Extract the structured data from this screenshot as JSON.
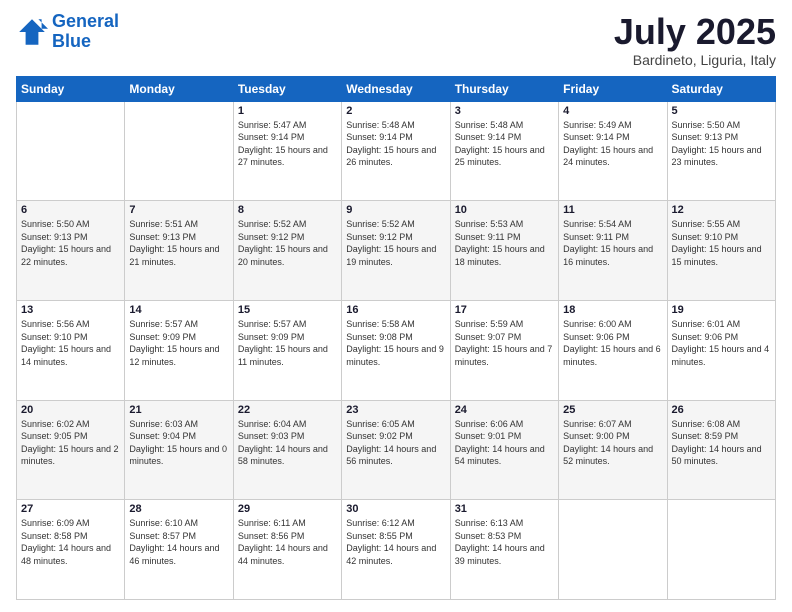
{
  "logo": {
    "line1": "General",
    "line2": "Blue"
  },
  "title": "July 2025",
  "location": "Bardineto, Liguria, Italy",
  "days_of_week": [
    "Sunday",
    "Monday",
    "Tuesday",
    "Wednesday",
    "Thursday",
    "Friday",
    "Saturday"
  ],
  "weeks": [
    [
      {
        "day": "",
        "sunrise": "",
        "sunset": "",
        "daylight": ""
      },
      {
        "day": "",
        "sunrise": "",
        "sunset": "",
        "daylight": ""
      },
      {
        "day": "1",
        "sunrise": "Sunrise: 5:47 AM",
        "sunset": "Sunset: 9:14 PM",
        "daylight": "Daylight: 15 hours and 27 minutes."
      },
      {
        "day": "2",
        "sunrise": "Sunrise: 5:48 AM",
        "sunset": "Sunset: 9:14 PM",
        "daylight": "Daylight: 15 hours and 26 minutes."
      },
      {
        "day": "3",
        "sunrise": "Sunrise: 5:48 AM",
        "sunset": "Sunset: 9:14 PM",
        "daylight": "Daylight: 15 hours and 25 minutes."
      },
      {
        "day": "4",
        "sunrise": "Sunrise: 5:49 AM",
        "sunset": "Sunset: 9:14 PM",
        "daylight": "Daylight: 15 hours and 24 minutes."
      },
      {
        "day": "5",
        "sunrise": "Sunrise: 5:50 AM",
        "sunset": "Sunset: 9:13 PM",
        "daylight": "Daylight: 15 hours and 23 minutes."
      }
    ],
    [
      {
        "day": "6",
        "sunrise": "Sunrise: 5:50 AM",
        "sunset": "Sunset: 9:13 PM",
        "daylight": "Daylight: 15 hours and 22 minutes."
      },
      {
        "day": "7",
        "sunrise": "Sunrise: 5:51 AM",
        "sunset": "Sunset: 9:13 PM",
        "daylight": "Daylight: 15 hours and 21 minutes."
      },
      {
        "day": "8",
        "sunrise": "Sunrise: 5:52 AM",
        "sunset": "Sunset: 9:12 PM",
        "daylight": "Daylight: 15 hours and 20 minutes."
      },
      {
        "day": "9",
        "sunrise": "Sunrise: 5:52 AM",
        "sunset": "Sunset: 9:12 PM",
        "daylight": "Daylight: 15 hours and 19 minutes."
      },
      {
        "day": "10",
        "sunrise": "Sunrise: 5:53 AM",
        "sunset": "Sunset: 9:11 PM",
        "daylight": "Daylight: 15 hours and 18 minutes."
      },
      {
        "day": "11",
        "sunrise": "Sunrise: 5:54 AM",
        "sunset": "Sunset: 9:11 PM",
        "daylight": "Daylight: 15 hours and 16 minutes."
      },
      {
        "day": "12",
        "sunrise": "Sunrise: 5:55 AM",
        "sunset": "Sunset: 9:10 PM",
        "daylight": "Daylight: 15 hours and 15 minutes."
      }
    ],
    [
      {
        "day": "13",
        "sunrise": "Sunrise: 5:56 AM",
        "sunset": "Sunset: 9:10 PM",
        "daylight": "Daylight: 15 hours and 14 minutes."
      },
      {
        "day": "14",
        "sunrise": "Sunrise: 5:57 AM",
        "sunset": "Sunset: 9:09 PM",
        "daylight": "Daylight: 15 hours and 12 minutes."
      },
      {
        "day": "15",
        "sunrise": "Sunrise: 5:57 AM",
        "sunset": "Sunset: 9:09 PM",
        "daylight": "Daylight: 15 hours and 11 minutes."
      },
      {
        "day": "16",
        "sunrise": "Sunrise: 5:58 AM",
        "sunset": "Sunset: 9:08 PM",
        "daylight": "Daylight: 15 hours and 9 minutes."
      },
      {
        "day": "17",
        "sunrise": "Sunrise: 5:59 AM",
        "sunset": "Sunset: 9:07 PM",
        "daylight": "Daylight: 15 hours and 7 minutes."
      },
      {
        "day": "18",
        "sunrise": "Sunrise: 6:00 AM",
        "sunset": "Sunset: 9:06 PM",
        "daylight": "Daylight: 15 hours and 6 minutes."
      },
      {
        "day": "19",
        "sunrise": "Sunrise: 6:01 AM",
        "sunset": "Sunset: 9:06 PM",
        "daylight": "Daylight: 15 hours and 4 minutes."
      }
    ],
    [
      {
        "day": "20",
        "sunrise": "Sunrise: 6:02 AM",
        "sunset": "Sunset: 9:05 PM",
        "daylight": "Daylight: 15 hours and 2 minutes."
      },
      {
        "day": "21",
        "sunrise": "Sunrise: 6:03 AM",
        "sunset": "Sunset: 9:04 PM",
        "daylight": "Daylight: 15 hours and 0 minutes."
      },
      {
        "day": "22",
        "sunrise": "Sunrise: 6:04 AM",
        "sunset": "Sunset: 9:03 PM",
        "daylight": "Daylight: 14 hours and 58 minutes."
      },
      {
        "day": "23",
        "sunrise": "Sunrise: 6:05 AM",
        "sunset": "Sunset: 9:02 PM",
        "daylight": "Daylight: 14 hours and 56 minutes."
      },
      {
        "day": "24",
        "sunrise": "Sunrise: 6:06 AM",
        "sunset": "Sunset: 9:01 PM",
        "daylight": "Daylight: 14 hours and 54 minutes."
      },
      {
        "day": "25",
        "sunrise": "Sunrise: 6:07 AM",
        "sunset": "Sunset: 9:00 PM",
        "daylight": "Daylight: 14 hours and 52 minutes."
      },
      {
        "day": "26",
        "sunrise": "Sunrise: 6:08 AM",
        "sunset": "Sunset: 8:59 PM",
        "daylight": "Daylight: 14 hours and 50 minutes."
      }
    ],
    [
      {
        "day": "27",
        "sunrise": "Sunrise: 6:09 AM",
        "sunset": "Sunset: 8:58 PM",
        "daylight": "Daylight: 14 hours and 48 minutes."
      },
      {
        "day": "28",
        "sunrise": "Sunrise: 6:10 AM",
        "sunset": "Sunset: 8:57 PM",
        "daylight": "Daylight: 14 hours and 46 minutes."
      },
      {
        "day": "29",
        "sunrise": "Sunrise: 6:11 AM",
        "sunset": "Sunset: 8:56 PM",
        "daylight": "Daylight: 14 hours and 44 minutes."
      },
      {
        "day": "30",
        "sunrise": "Sunrise: 6:12 AM",
        "sunset": "Sunset: 8:55 PM",
        "daylight": "Daylight: 14 hours and 42 minutes."
      },
      {
        "day": "31",
        "sunrise": "Sunrise: 6:13 AM",
        "sunset": "Sunset: 8:53 PM",
        "daylight": "Daylight: 14 hours and 39 minutes."
      },
      {
        "day": "",
        "sunrise": "",
        "sunset": "",
        "daylight": ""
      },
      {
        "day": "",
        "sunrise": "",
        "sunset": "",
        "daylight": ""
      }
    ]
  ]
}
